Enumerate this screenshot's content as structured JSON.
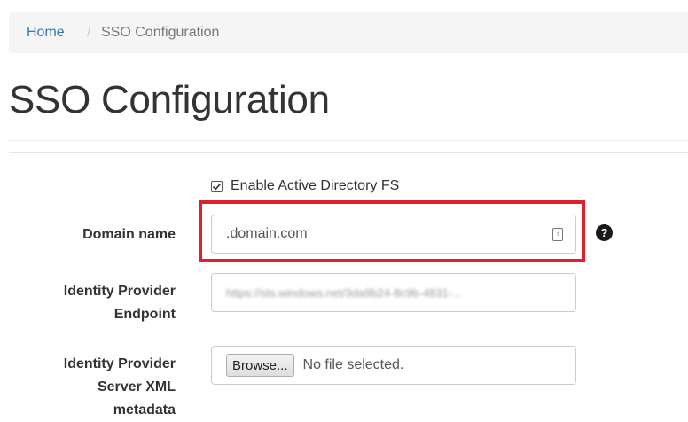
{
  "breadcrumb": {
    "home": "Home",
    "separator": "/",
    "current": "SSO Configuration"
  },
  "page_title": "SSO Configuration",
  "adfs_checkbox": {
    "label": "Enable Active Directory FS",
    "checked": true
  },
  "form": {
    "domain": {
      "label": "Domain name",
      "value": ".domain.com",
      "icon": "form-autofill-icon",
      "help_icon": "question-circle-icon"
    },
    "endpoint": {
      "label_line1": "Identity Provider",
      "label_line2": "Endpoint",
      "value": "https://sts.windows.net/3da9b24-8c9b-4831-..."
    },
    "metadata": {
      "label_line1": "Identity Provider",
      "label_line2": "Server XML",
      "label_line3": "metadata",
      "browse_label": "Browse...",
      "file_status": "No file selected."
    }
  },
  "colors": {
    "link": "#337ab7",
    "highlight": "#e0202a",
    "breadcrumb_bg": "#f5f5f5"
  }
}
